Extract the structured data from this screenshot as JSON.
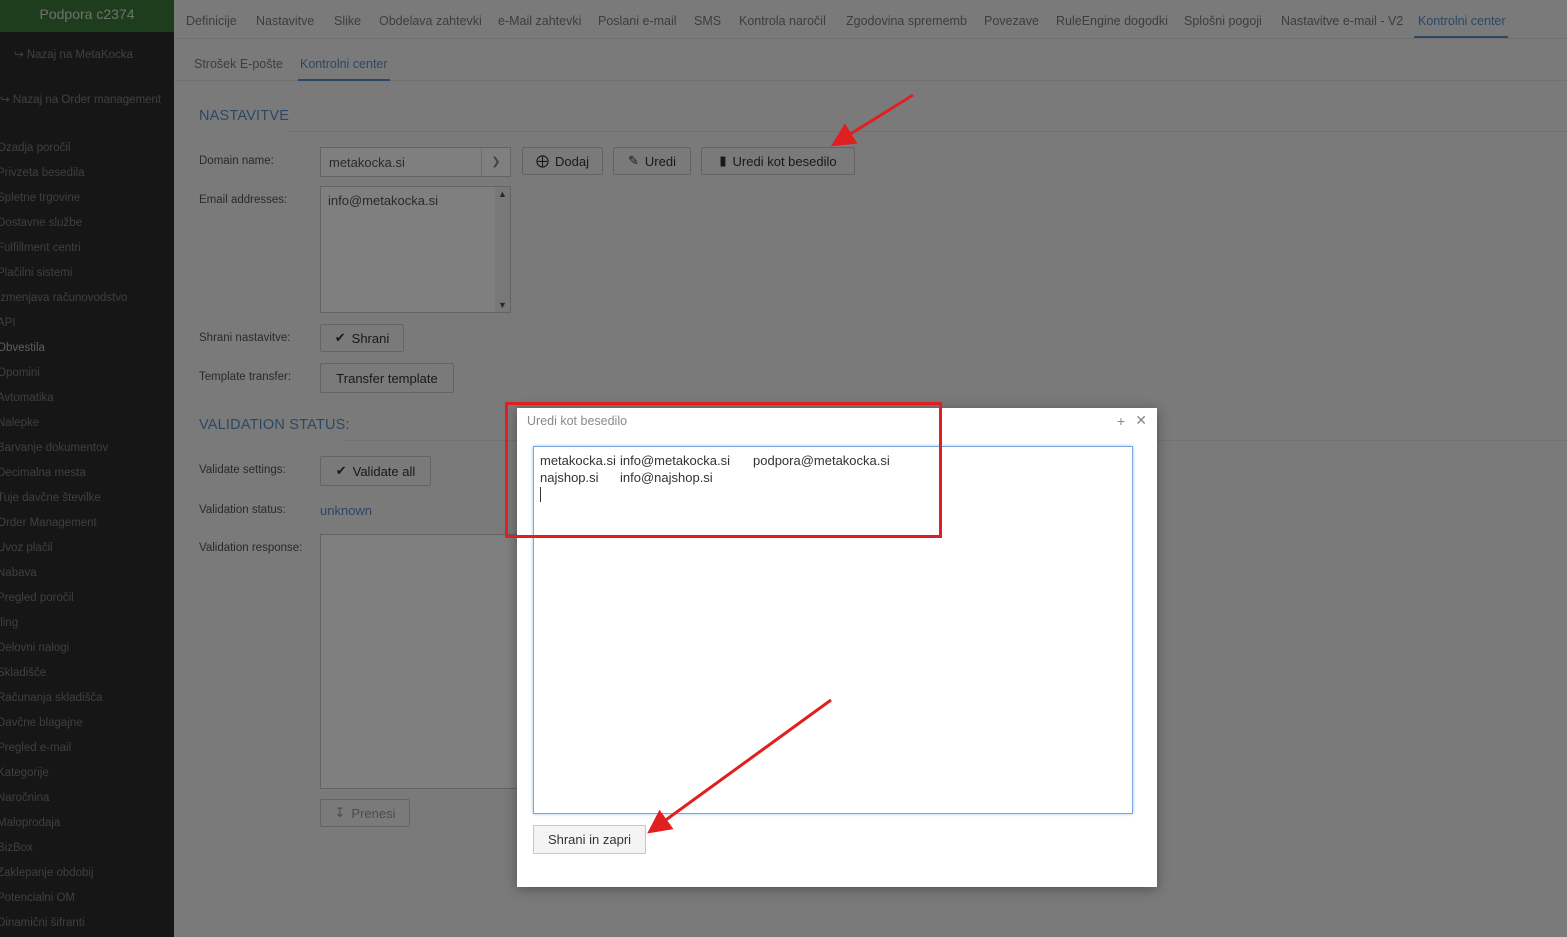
{
  "sidebar": {
    "header": "Podpora c2374",
    "back_metakocka": "↪ Nazaj na MetaKocka",
    "back_order": "↪ Nazaj na Order management",
    "items": [
      "Ozadja poročil",
      "Privzeta besedila",
      "Spletne trgovine",
      "Dostavne službe",
      "Fulfillment centri",
      "Plačilni sistemi",
      "Izmenjava računovodstvo",
      "API",
      "Obvestila",
      "Opomini",
      "Avtomatika",
      "Nalepke",
      "Barvanje dokumentov",
      "Decimalna mesta",
      "Tuje davčne številke",
      "Order Management",
      "Uvoz plačil",
      "Nabava",
      "Pregled poročil",
      "Iling",
      "Delovni nalogi",
      "Skladišče",
      "Računanja skladišča",
      "Davčne blagajne",
      "Pregled e-mail",
      "Kategorije",
      "Naročnina",
      "Maloprodaja",
      "BizBox",
      "Zaklepanje obdobij",
      "Potencialni OM",
      "Dinamični šifranti"
    ]
  },
  "topnav": {
    "tabs": [
      "Definicije",
      "Nastavitve",
      "Slike",
      "Obdelava zahtevki",
      "e-Mail zahtevki",
      "Poslani e-mail",
      "SMS",
      "Kontrola naročil",
      "Zgodovina sprememb",
      "Povezave",
      "RuleEngine dogodki",
      "Splošni pogoji",
      "Nastavitve e-mail - V2",
      "Kontrolni center"
    ]
  },
  "subnav": {
    "tabs": [
      "Strošek E-pošte",
      "Kontrolni center"
    ]
  },
  "settings": {
    "title": "NASTAVITVE",
    "domain_label": "Domain name:",
    "domain_value": "metakocka.si",
    "add_button": "Dodaj",
    "edit_button": "Uredi",
    "edit_text_button": "Uredi kot besedilo",
    "email_label": "Email addresses:",
    "email_value": "info@metakocka.si",
    "save_label": "Shrani nastavitve:",
    "save_button": "Shrani",
    "template_label": "Template transfer:",
    "template_button": "Transfer template"
  },
  "validation": {
    "title": "VALIDATION STATUS:",
    "settings_label": "Validate settings:",
    "validate_button": "Validate all",
    "status_label": "Validation status:",
    "status_value": "unknown",
    "response_label": "Validation response:",
    "download_button": "Prenesi"
  },
  "dialog": {
    "title": "Uredi kot besedilo",
    "rows": [
      [
        "metakocka.si",
        "info@metakocka.si",
        "podpora@metakocka.si"
      ],
      [
        "najshop.si",
        "info@najshop.si"
      ]
    ],
    "save_close_button": "Shrani in zapri"
  },
  "colors": {
    "accent": "#5b8fc7",
    "sidebar_bg": "#2c2d2c",
    "sidebar_head": "#3d7a3a",
    "annotation": "#e02020"
  }
}
